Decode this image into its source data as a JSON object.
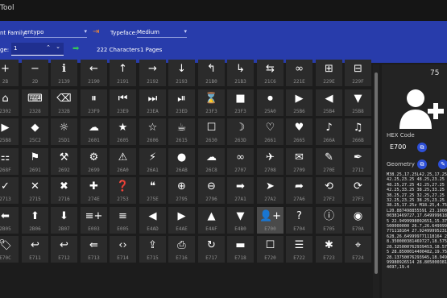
{
  "window": {
    "title": "Tool"
  },
  "toolbar": {
    "font_family_label": "nt Family:",
    "font_family_value": "entypo",
    "typeface_label": "Typeface:",
    "typeface_value": "Medium",
    "page_label": "ge:",
    "page_value": "1",
    "characters_text": "222 Characters",
    "pages_text": "1 Pages"
  },
  "glyphs": [
    {
      "icon": "+",
      "code": "2B"
    },
    {
      "icon": "−",
      "code": "2D"
    },
    {
      "icon": "ℹ",
      "code": "2139"
    },
    {
      "icon": "←",
      "code": "2190"
    },
    {
      "icon": "↑",
      "code": "2191"
    },
    {
      "icon": "→",
      "code": "2192"
    },
    {
      "icon": "↓",
      "code": "2193"
    },
    {
      "icon": "↰",
      "code": "21B0"
    },
    {
      "icon": "↳",
      "code": "21B3"
    },
    {
      "icon": "⇆",
      "code": "21C6"
    },
    {
      "icon": "∞",
      "code": "221E"
    },
    {
      "icon": "⊞",
      "code": "229E"
    },
    {
      "icon": "⊟",
      "code": "229F"
    },
    {
      "icon": "⌂",
      "code": "2302"
    },
    {
      "icon": "⌨",
      "code": "2328"
    },
    {
      "icon": "⌫",
      "code": "232B"
    },
    {
      "icon": "⏸",
      "code": "23F9"
    },
    {
      "icon": "⏮",
      "code": "23E9"
    },
    {
      "icon": "⏭",
      "code": "23EA"
    },
    {
      "icon": "⏯",
      "code": "23ED"
    },
    {
      "icon": "⌛",
      "code": "23F3"
    },
    {
      "icon": "■",
      "code": "23F3"
    },
    {
      "icon": "⏺",
      "code": "25A0"
    },
    {
      "icon": "▶",
      "code": "25B6"
    },
    {
      "icon": "◀",
      "code": "25B4"
    },
    {
      "icon": "▼",
      "code": "25B8"
    },
    {
      "icon": "▶",
      "code": "25B8"
    },
    {
      "icon": "◆",
      "code": "25C2"
    },
    {
      "icon": "☼",
      "code": "25D1"
    },
    {
      "icon": "☁",
      "code": "2601"
    },
    {
      "icon": "★",
      "code": "2605"
    },
    {
      "icon": "☆",
      "code": "2606"
    },
    {
      "icon": "☕",
      "code": "2615"
    },
    {
      "icon": "☐",
      "code": "2630"
    },
    {
      "icon": "☽",
      "code": "263D"
    },
    {
      "icon": "♡",
      "code": "2661"
    },
    {
      "icon": "♥",
      "code": "2665"
    },
    {
      "icon": "♪",
      "code": "266A"
    },
    {
      "icon": "♫",
      "code": "266B"
    },
    {
      "icon": "⚏",
      "code": "268F"
    },
    {
      "icon": "⚑",
      "code": "2691"
    },
    {
      "icon": "⚒",
      "code": "2692"
    },
    {
      "icon": "⚙",
      "code": "2699"
    },
    {
      "icon": "⚠",
      "code": "26A0"
    },
    {
      "icon": "⚡",
      "code": "26A1"
    },
    {
      "icon": "●",
      "code": "26AB"
    },
    {
      "icon": "☁",
      "code": "26C8"
    },
    {
      "icon": "∞",
      "code": "2707"
    },
    {
      "icon": "✈",
      "code": "2708"
    },
    {
      "icon": "✉",
      "code": "2709"
    },
    {
      "icon": "✎",
      "code": "270E"
    },
    {
      "icon": "✒",
      "code": "2712"
    },
    {
      "icon": "✓",
      "code": "2713"
    },
    {
      "icon": "✕",
      "code": "2715"
    },
    {
      "icon": "✖",
      "code": "2716"
    },
    {
      "icon": "✚",
      "code": "274E"
    },
    {
      "icon": "❓",
      "code": "2753"
    },
    {
      "icon": "❝",
      "code": "275E"
    },
    {
      "icon": "⊕",
      "code": "2795"
    },
    {
      "icon": "⊖",
      "code": "2796"
    },
    {
      "icon": "➡",
      "code": "27A1"
    },
    {
      "icon": "➤",
      "code": "27A2"
    },
    {
      "icon": "➦",
      "code": "27A6"
    },
    {
      "icon": "⟲",
      "code": "27F2"
    },
    {
      "icon": "⟳",
      "code": "27F3"
    },
    {
      "icon": "⬅",
      "code": "2B05"
    },
    {
      "icon": "⬆",
      "code": "2B06"
    },
    {
      "icon": "⬇",
      "code": "2B07"
    },
    {
      "icon": "≡+",
      "code": "E003"
    },
    {
      "icon": "≡",
      "code": "E005"
    },
    {
      "icon": "◀",
      "code": "E4AD"
    },
    {
      "icon": "▶",
      "code": "E4AE"
    },
    {
      "icon": "▲",
      "code": "E4AF"
    },
    {
      "icon": "▼",
      "code": "E4B0"
    },
    {
      "icon": "👤+",
      "code": "E700"
    },
    {
      "icon": "?",
      "code": "E704"
    },
    {
      "icon": "ⓘ",
      "code": "E705"
    },
    {
      "icon": "◉",
      "code": "E70A"
    },
    {
      "icon": "🏷",
      "code": "E70C"
    },
    {
      "icon": "↩",
      "code": "E711"
    },
    {
      "icon": "↩",
      "code": "E712"
    },
    {
      "icon": "⇚",
      "code": "E713"
    },
    {
      "icon": "‹›",
      "code": "E714"
    },
    {
      "icon": "⇪",
      "code": "E715"
    },
    {
      "icon": "⎙",
      "code": "E716"
    },
    {
      "icon": "↻",
      "code": "E717"
    },
    {
      "icon": "▬",
      "code": "E718"
    },
    {
      "icon": "☐",
      "code": "E720"
    },
    {
      "icon": "☰",
      "code": "E722"
    },
    {
      "icon": "✱",
      "code": "E723"
    },
    {
      "icon": "⌖",
      "code": "E724"
    }
  ],
  "panel": {
    "count": "75",
    "hex_code_label": "HEX Code",
    "hex_code_value": "E700",
    "geometry_label": "Geometry",
    "geometry_text": "M38.25,17.25L42.25,17.25 42.25,23.25 48.25,23.25 48.25,27.25 42.25,27.25 42.25,33.25 38.25,33.25 38.25,27.25 32.25,27.25 32.25,23.25 38.25,23.25 38.25,17.25z M18.25,4.75L20.887498855591 23.100000381469727,17.6499996185 22.9499998092651,15.37500000000 26.7,26.649999771118164 27.92499995231628,26.649999771118164 28.350000381469727,18.575 28.325000762939453,18.575 28.8500014400482,19.75 28.13750076293945,18.94999980926514 28.8050003814697,19.4"
  },
  "colors": {
    "toolbar": "#283CAB",
    "accent": "#2D4FD6",
    "go_arrow": "#34C759",
    "background": "#1C1C1C",
    "tile": "#2B2B2B",
    "tile_selected": "#4A4A4A"
  }
}
